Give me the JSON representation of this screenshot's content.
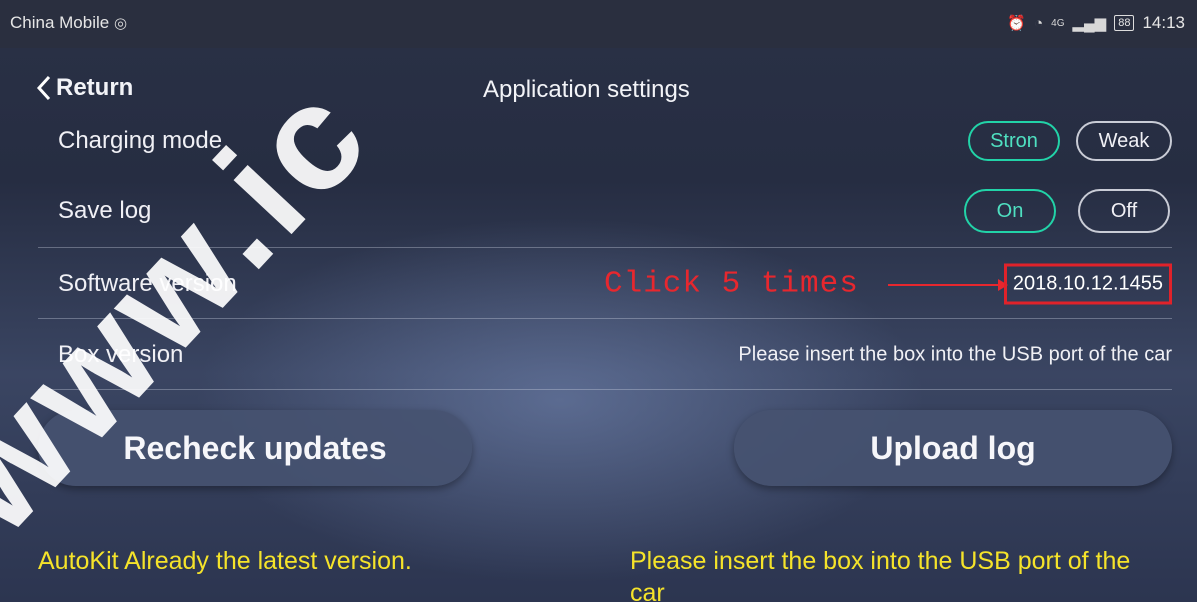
{
  "status_bar": {
    "carrier": "China Mobile",
    "carrier_icon": "weibo-icon",
    "network": "4G",
    "battery": "88",
    "time": "14:13"
  },
  "nav": {
    "back_label": "Return",
    "title": "Application settings"
  },
  "settings": {
    "charging_mode": {
      "label": "Charging mode",
      "options": [
        "Stron",
        "Weak"
      ],
      "selected": "Stron"
    },
    "save_log": {
      "label": "Save log",
      "options": [
        "On",
        "Off"
      ],
      "selected": "On"
    },
    "software_version": {
      "label": "Software version",
      "value": "2018.10.12.1455"
    },
    "box_version": {
      "label": "Box version",
      "value": "Please insert the box into the USB port of the car"
    }
  },
  "annotation": {
    "text": "Click 5 times",
    "color": "#e7272e"
  },
  "buttons": {
    "recheck": "Recheck updates",
    "upload": "Upload log"
  },
  "messages": {
    "left": "AutoKit Already the latest version.",
    "right": "Please insert the box into the USB port of the car"
  },
  "watermark": "www.ic",
  "colors": {
    "accent": "#22d3a8",
    "message": "#f5e32a",
    "highlight_box": "#e0222a"
  }
}
